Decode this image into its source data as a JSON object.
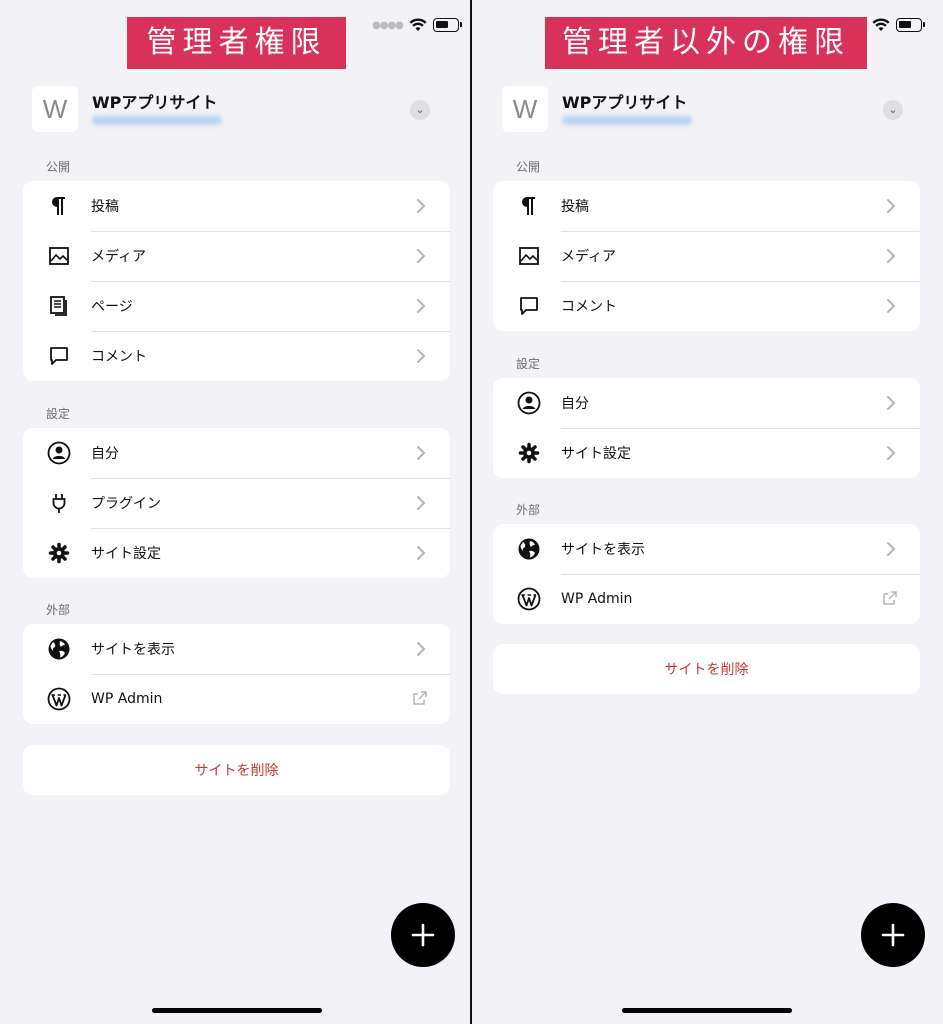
{
  "left": {
    "banner": "管理者権限",
    "site": {
      "icon_letter": "W",
      "title": "WPアプリサイト"
    },
    "sections": [
      {
        "label": "公開",
        "items": [
          {
            "icon": "pilcrow-icon",
            "label": "投稿",
            "trail": "chevron"
          },
          {
            "icon": "image-icon",
            "label": "メディア",
            "trail": "chevron"
          },
          {
            "icon": "pages-icon",
            "label": "ページ",
            "trail": "chevron"
          },
          {
            "icon": "comment-icon",
            "label": "コメント",
            "trail": "chevron"
          }
        ]
      },
      {
        "label": "設定",
        "items": [
          {
            "icon": "user-icon",
            "label": "自分",
            "trail": "chevron"
          },
          {
            "icon": "plugin-icon",
            "label": "プラグイン",
            "trail": "chevron"
          },
          {
            "icon": "gear-icon",
            "label": "サイト設定",
            "trail": "chevron"
          }
        ]
      },
      {
        "label": "外部",
        "items": [
          {
            "icon": "globe-icon",
            "label": "サイトを表示",
            "trail": "chevron"
          },
          {
            "icon": "wordpress-icon",
            "label": "WP Admin",
            "trail": "external"
          }
        ]
      }
    ],
    "delete_label": "サイトを削除"
  },
  "right": {
    "banner": "管理者以外の権限",
    "site": {
      "icon_letter": "W",
      "title": "WPアプリサイト"
    },
    "sections": [
      {
        "label": "公開",
        "items": [
          {
            "icon": "pilcrow-icon",
            "label": "投稿",
            "trail": "chevron"
          },
          {
            "icon": "image-icon",
            "label": "メディア",
            "trail": "chevron"
          },
          {
            "icon": "comment-icon",
            "label": "コメント",
            "trail": "chevron"
          }
        ]
      },
      {
        "label": "設定",
        "items": [
          {
            "icon": "user-icon",
            "label": "自分",
            "trail": "chevron"
          },
          {
            "icon": "gear-icon",
            "label": "サイト設定",
            "trail": "chevron"
          }
        ]
      },
      {
        "label": "外部",
        "items": [
          {
            "icon": "globe-icon",
            "label": "サイトを表示",
            "trail": "chevron"
          },
          {
            "icon": "wordpress-icon",
            "label": "WP Admin",
            "trail": "external"
          }
        ]
      }
    ],
    "delete_label": "サイトを削除"
  },
  "colors": {
    "banner": "#d8325a",
    "danger": "#c7392f",
    "background": "#f2f2f7"
  }
}
